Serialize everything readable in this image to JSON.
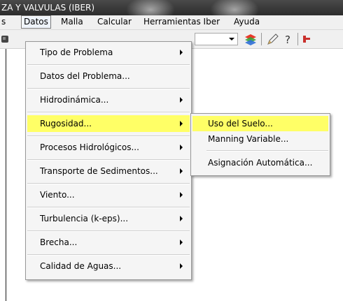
{
  "window": {
    "title": "ZA Y VALVULAS (IBER)"
  },
  "menubar": {
    "items": [
      {
        "label": "s"
      },
      {
        "label": "Datos"
      },
      {
        "label": "Malla"
      },
      {
        "label": "Calcular"
      },
      {
        "label": "Herramientas Iber"
      },
      {
        "label": "Ayuda"
      }
    ]
  },
  "toolbar": {
    "combo_value": "",
    "icons": [
      "app-icon",
      "layers-icon",
      "edit-pencil-icon",
      "help-question-icon",
      "partial-tool-icon"
    ]
  },
  "datos_menu": {
    "items": [
      {
        "label": "Tipo de Problema",
        "has_submenu": true
      },
      {
        "label": "Datos del Problema...",
        "has_submenu": false
      },
      {
        "label": "Hidrodinámica...",
        "has_submenu": true
      },
      {
        "label": "Rugosidad...",
        "has_submenu": true,
        "highlighted": true
      },
      {
        "label": "Procesos Hidrológicos...",
        "has_submenu": true
      },
      {
        "label": "Transporte de Sedimentos...",
        "has_submenu": true
      },
      {
        "label": "Viento...",
        "has_submenu": true
      },
      {
        "label": "Turbulencia (k-eps)...",
        "has_submenu": true
      },
      {
        "label": "Brecha...",
        "has_submenu": true
      },
      {
        "label": "Calidad de Aguas...",
        "has_submenu": true
      }
    ]
  },
  "rugosidad_submenu": {
    "items": [
      {
        "label": "Uso del Suelo...",
        "highlighted": true
      },
      {
        "label": "Manning Variable..."
      },
      {
        "label": "Asignación Automática..."
      }
    ]
  },
  "colors": {
    "highlight": "#ffff66",
    "title_bar": "#333333",
    "menu_bg": "#f5f5f5"
  }
}
